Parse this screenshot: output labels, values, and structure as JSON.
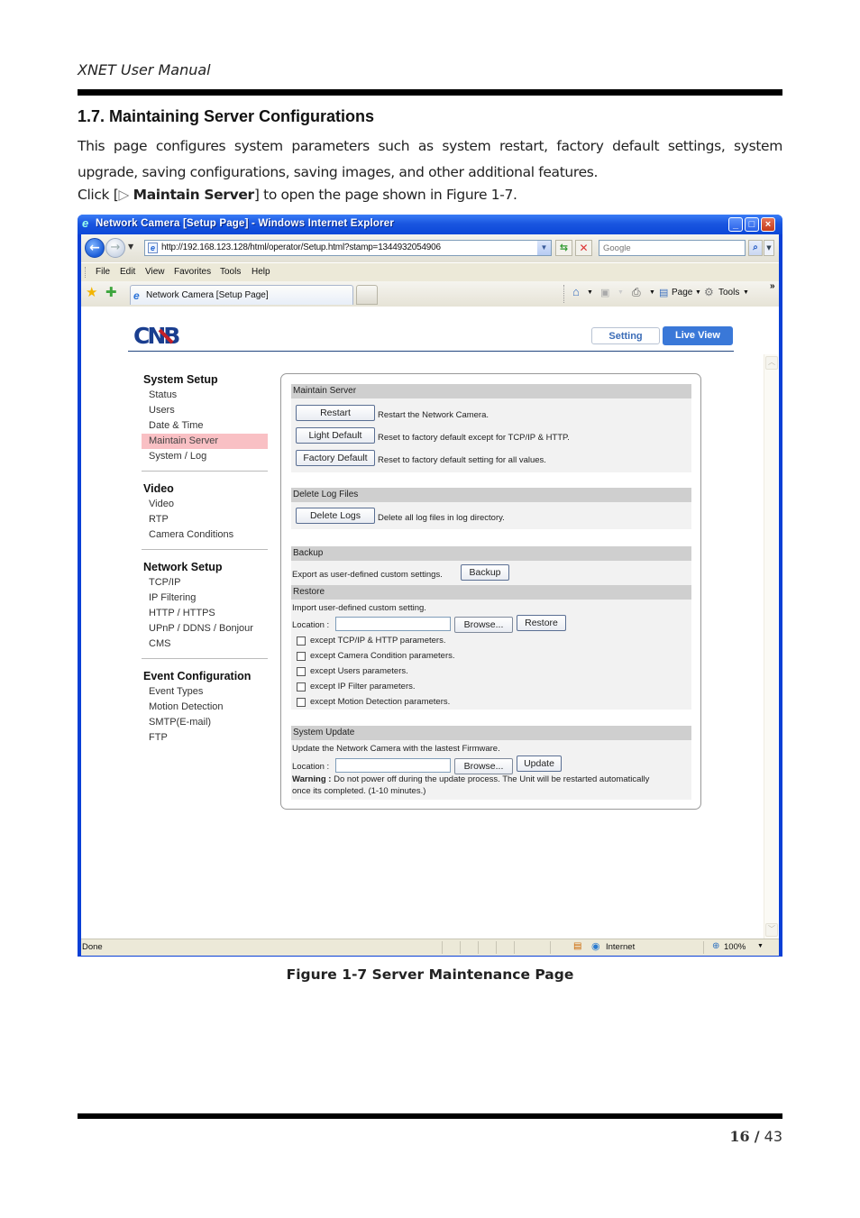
{
  "document": {
    "header": "XNET User Manual",
    "section_title": "1.7. Maintaining Server Configurations",
    "paragraph": "This page configures system parameters such as system restart, factory default settings, system upgrade, saving configurations, saving images, and other additional features.",
    "click_prefix": "Click [",
    "click_arrow": "▷",
    "click_bold": "Maintain Server",
    "click_suffix": "] to open the page shown in Figure 1-7.",
    "figure_caption": "Figure 1-7 Server Maintenance Page",
    "page_current": "16",
    "page_sep": "/",
    "page_total": "43"
  },
  "browser": {
    "title": "Network Camera [Setup Page] - Windows Internet Explorer",
    "address": "http://192.168.123.128/html/operator/Setup.html?stamp=1344932054906",
    "search_placeholder": "Google",
    "menu": [
      "File",
      "Edit",
      "View",
      "Favorites",
      "Tools",
      "Help"
    ],
    "tab_title": "Network Camera [Setup Page]",
    "command_page": "Page",
    "command_tools": "Tools",
    "status_text": "Done",
    "zone": "Internet",
    "zoom": "100%"
  },
  "app": {
    "logo": "CNB",
    "btn_setting": "Setting",
    "btn_live_view": "Live View",
    "sidebar": [
      {
        "heading": "System Setup",
        "items": [
          "Status",
          "Users",
          "Date & Time",
          "Maintain Server",
          "System / Log"
        ],
        "active": 3
      },
      {
        "heading": "Video",
        "items": [
          "Video",
          "RTP",
          "Camera Conditions"
        ]
      },
      {
        "heading": "Network Setup",
        "items": [
          "TCP/IP",
          "IP Filtering",
          "HTTP / HTTPS",
          "UPnP / DDNS / Bonjour",
          "CMS"
        ]
      },
      {
        "heading": "Event Configuration",
        "items": [
          "Event Types",
          "Motion Detection",
          "SMTP(E-mail)",
          "FTP"
        ]
      }
    ],
    "maintain": {
      "title": "Maintain Server",
      "restart_btn": "Restart",
      "restart_desc": "Restart the Network Camera.",
      "light_btn": "Light Default",
      "light_desc": "Reset to factory default except for TCP/IP & HTTP.",
      "factory_btn": "Factory Default",
      "factory_desc": "Reset to factory default setting for all values."
    },
    "delete_logs": {
      "title": "Delete Log Files",
      "btn": "Delete Logs",
      "desc": "Delete all log files in log directory."
    },
    "backup": {
      "title": "Backup",
      "desc": "Export as user-defined custom settings.",
      "btn": "Backup"
    },
    "restore": {
      "title": "Restore",
      "desc": "Import user-defined custom setting.",
      "location_label": "Location :",
      "location_value": "",
      "browse_btn": "Browse...",
      "restore_btn": "Restore",
      "options": [
        {
          "label": "except TCP/IP & HTTP parameters.",
          "checked": false
        },
        {
          "label": "except Camera Condition parameters.",
          "checked": false
        },
        {
          "label": "except Users parameters.",
          "checked": false
        },
        {
          "label": "except IP Filter parameters.",
          "checked": false
        },
        {
          "label": "except Motion Detection parameters.",
          "checked": false
        }
      ]
    },
    "update": {
      "title": "System Update",
      "desc": "Update the Network Camera with the lastest Firmware.",
      "location_label": "Location :",
      "location_value": "",
      "browse_btn": "Browse...",
      "update_btn": "Update",
      "warning_label": "Warning :",
      "warning_text": " Do not power off during the update process. The Unit will be restarted automatically",
      "warning_text2": "once its completed. (1-10 minutes.)"
    }
  }
}
